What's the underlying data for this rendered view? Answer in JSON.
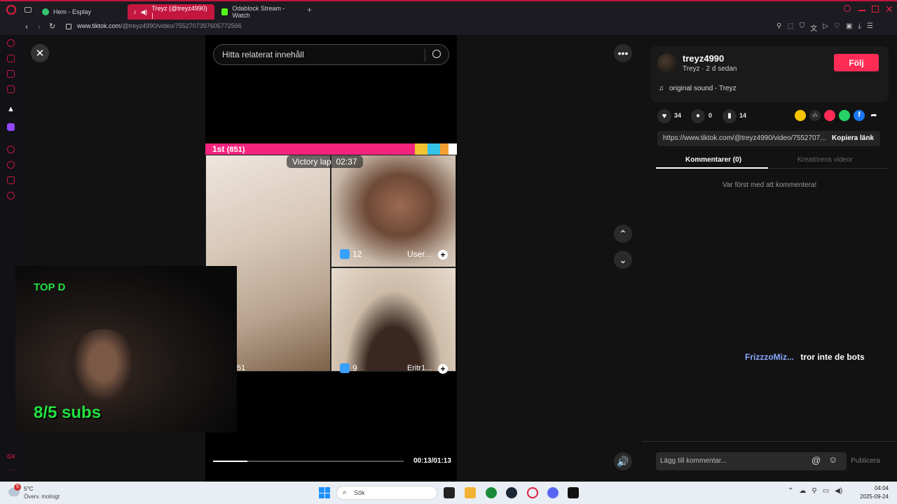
{
  "browser": {
    "tabs": [
      {
        "label": "Hem - Esplay",
        "color": "#36c36f"
      },
      {
        "label": "Treyz (@treyz4990) |",
        "color": "#ffffff"
      },
      {
        "label": "Odablock Stream - Watch",
        "color": "#53fc18"
      }
    ],
    "new_tab": "+",
    "url_host": "www.tiktok.com",
    "url_path": "/@treyz4990/video/7552707397605772566"
  },
  "search": {
    "placeholder": "Hitta relaterat innehåll"
  },
  "video": {
    "rank": "1st",
    "rank_score": "(851)",
    "victory_lap": "Victory lap",
    "countdown": "02:37",
    "cell_b_gifts": "12",
    "cell_b_user": "User...",
    "cell_c_gifts": "9",
    "cell_c_user": "Eritr1...",
    "cell_a_count": "51",
    "time": "00:13/01:13",
    "progress": 0.18
  },
  "webcam": {
    "title": "TOP D",
    "subs": "8/5 subs"
  },
  "author": {
    "username": "treyz4990",
    "subline": "Treyz · 2 d sedan",
    "follow_label": "Följ",
    "sound": "original sound - Treyz"
  },
  "stats": {
    "likes": "34",
    "comments": "0",
    "saves": "14"
  },
  "link": {
    "url": "https://www.tiktok.com/@treyz4990/video/7552707...",
    "copy_label": "Kopiera länk"
  },
  "tabs": {
    "comments": "Kommentarer (0)",
    "creator_videos": "Kreatörens videor"
  },
  "comments": {
    "empty": "Var först med att kommentera!",
    "live_user": "FrizzzoMiz...",
    "live_text": "tror inte de bots",
    "placeholder": "Lägg till kommentar...",
    "post": "Publicera"
  },
  "taskbar": {
    "temp": "5°C",
    "weather": "Överv. molnigt",
    "weather_badge": "5",
    "search": "Sök",
    "time": "04:04",
    "date": "2025-09-24"
  },
  "colors": {
    "accent": "#fe2c55",
    "browser_red": "#c4173f",
    "cam_green": "#22e040"
  }
}
